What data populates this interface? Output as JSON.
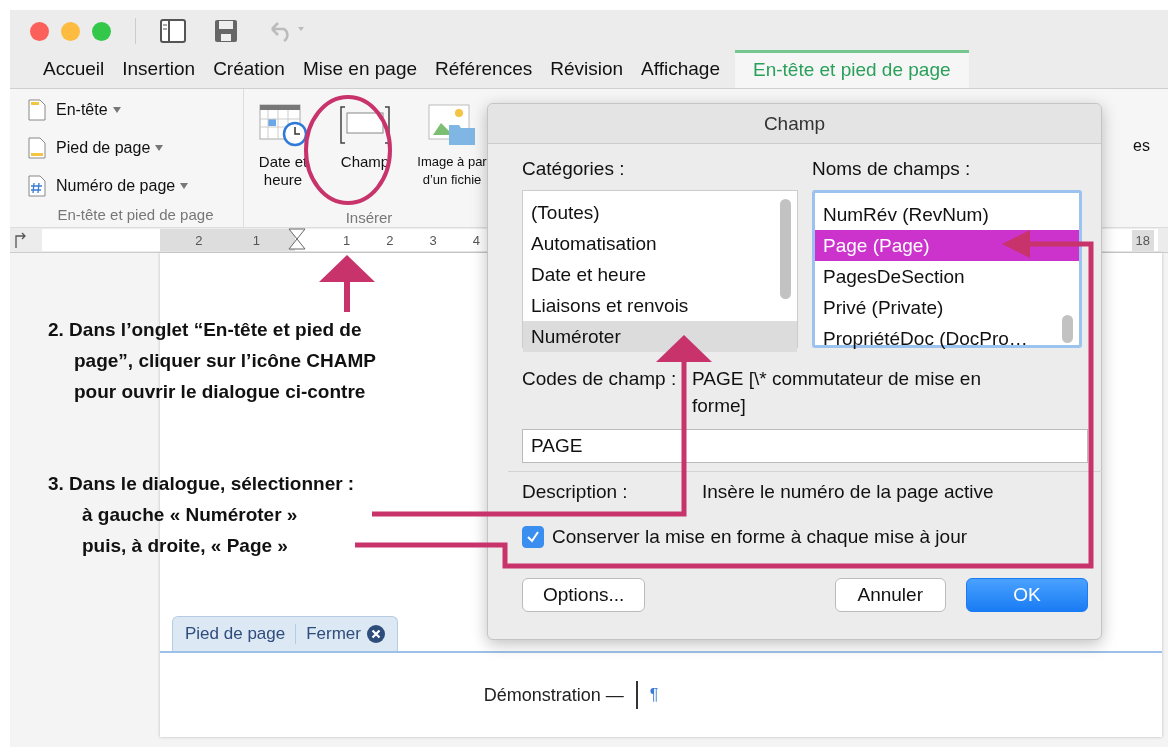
{
  "tabs": [
    {
      "label": "Accueil",
      "selected": false
    },
    {
      "label": "Insertion",
      "selected": false
    },
    {
      "label": "Création",
      "selected": false
    },
    {
      "label": "Mise en page",
      "selected": false
    },
    {
      "label": "Références",
      "selected": false
    },
    {
      "label": "Révision",
      "selected": false
    },
    {
      "label": "Affichage",
      "selected": false
    },
    {
      "label": "En-tête et pied de page",
      "selected": true
    }
  ],
  "ribbon": {
    "group1": {
      "items": [
        {
          "label": "En-tête",
          "kind": "header"
        },
        {
          "label": "Pied de page",
          "kind": "footer"
        },
        {
          "label": "Numéro de page",
          "kind": "number"
        }
      ],
      "caption": "En-tête et pied de page"
    },
    "group2": {
      "buttons": [
        {
          "lines": [
            "Date et",
            "heure"
          ],
          "kind": "date"
        },
        {
          "lines": [
            "Champ"
          ],
          "kind": "field"
        },
        {
          "lines": [
            "Image à par",
            "d’un fichie"
          ],
          "kind": "image"
        }
      ],
      "caption": "Insérer"
    },
    "partial_label": "es"
  },
  "ruler": {
    "left_numbers": [
      "2",
      "1"
    ],
    "right_numbers": [
      "1",
      "2",
      "3",
      "4"
    ],
    "end_number": "18"
  },
  "steps": [
    {
      "lines": [
        "2. Dans l’onglet “En-tête et pied de",
        "page”, cliquer sur l’icône CHAMP",
        "pour ouvrir le dialogue ci-contre"
      ]
    },
    {
      "lines": [
        "3. Dans le dialogue, sélectionner  :",
        "à gauche « Numéroter »",
        "puis, à droite, « Page »"
      ]
    }
  ],
  "dialog": {
    "title": "Champ",
    "categories_label": "Catégories :",
    "categories": [
      {
        "label": "(Toutes)",
        "selected": false
      },
      {
        "label": "Automatisation",
        "selected": false
      },
      {
        "label": "Date et heure",
        "selected": false
      },
      {
        "label": "Liaisons et renvois",
        "selected": false
      },
      {
        "label": "Numéroter",
        "selected": true
      }
    ],
    "fields_label": "Noms de champs :",
    "fields": [
      {
        "label": "NumRév (RevNum)",
        "selected": false
      },
      {
        "label": "Page (Page)",
        "selected": true
      },
      {
        "label": "PagesDeSection",
        "selected": false
      },
      {
        "label": "Privé (Private)",
        "selected": false
      },
      {
        "label": "PropriétéDoc (DocPro…",
        "selected": false
      }
    ],
    "codes_label": "Codes de champ :",
    "codes_text": "PAGE [\\* commutateur de mise en forme]",
    "code_value": "PAGE",
    "description_label": "Description :",
    "description": "Insère le numéro de la page active",
    "keep_format": {
      "label": "Conserver la mise en forme à chaque mise à jour",
      "checked": true
    },
    "buttons": [
      {
        "label": "Options...",
        "kind": "default"
      },
      {
        "label": "Annuler",
        "kind": "default"
      },
      {
        "label": "OK",
        "kind": "primary"
      }
    ]
  },
  "footer": {
    "tab_label": "Pied de page",
    "close_label": "Fermer",
    "text": "Démonstration —",
    "mark": "¶"
  }
}
